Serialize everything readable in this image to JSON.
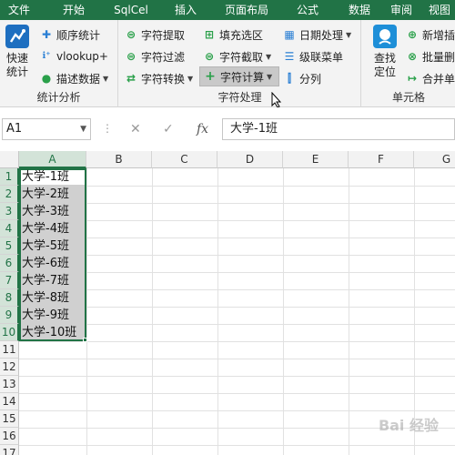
{
  "menu": [
    "文件",
    "开始",
    "SqlCel",
    "插入",
    "页面布局",
    "公式",
    "数据",
    "审阅",
    "视图"
  ],
  "ribbon": {
    "stats": {
      "big_label_1": "快速",
      "big_label_2": "统计",
      "seq_stats": "顺序统计",
      "vlookup": "vlookup+",
      "describe": "描述数据",
      "label": "统计分析"
    },
    "chars": {
      "extract": "字符提取",
      "filter": "字符过滤",
      "convert": "字符转换",
      "fill_select": "填充选区",
      "cut": "字符截取",
      "calc": "字符计算",
      "date": "日期处理",
      "cascade": "级联菜单",
      "split": "分列",
      "label": "字符处理"
    },
    "cells": {
      "big_label_1": "查找",
      "big_label_2": "定位",
      "new_insert": "新增插",
      "batch_delete": "批量删",
      "merge": "合并单",
      "label": "单元格"
    }
  },
  "formula_bar": {
    "name_box": "A1",
    "value": "大学-1班",
    "fx": "fx"
  },
  "grid": {
    "columns": [
      "A",
      "B",
      "C",
      "D",
      "E",
      "F",
      "G"
    ],
    "rows": [
      "1",
      "2",
      "3",
      "4",
      "5",
      "6",
      "7",
      "8",
      "9",
      "10",
      "11",
      "12",
      "13",
      "14",
      "15",
      "16",
      "17"
    ],
    "cells": [
      "大学-1班",
      "大学-2班",
      "大学-3班",
      "大学-4班",
      "大学-5班",
      "大学-6班",
      "大学-7班",
      "大学-8班",
      "大学-9班",
      "大学-10班"
    ]
  },
  "watermark": "Bai 经验",
  "colors": {
    "accent": "#217346"
  }
}
